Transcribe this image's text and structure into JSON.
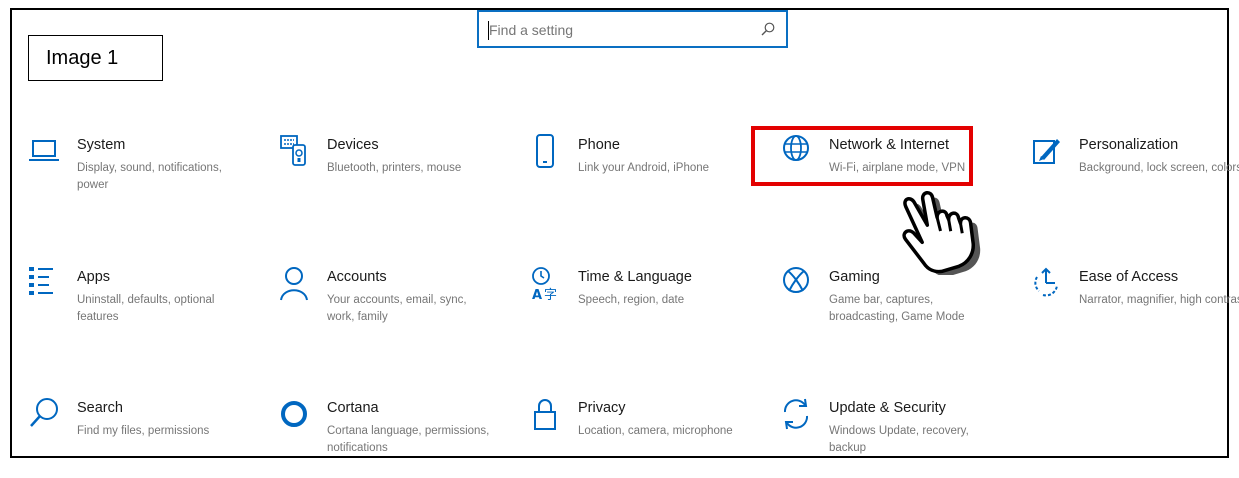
{
  "annotation": {
    "label": "Image 1"
  },
  "search": {
    "placeholder": "Find a setting",
    "icon": "search-icon"
  },
  "accent_color": "#0067c0",
  "highlight_color": "#e30000",
  "settings": [
    {
      "key": "system",
      "title": "System",
      "desc": "Display, sound, notifications, power",
      "icon": "laptop-icon"
    },
    {
      "key": "devices",
      "title": "Devices",
      "desc": "Bluetooth, printers, mouse",
      "icon": "devices-icon"
    },
    {
      "key": "phone",
      "title": "Phone",
      "desc": "Link your Android, iPhone",
      "icon": "phone-icon"
    },
    {
      "key": "network",
      "title": "Network & Internet",
      "desc": "Wi-Fi, airplane mode, VPN",
      "icon": "globe-icon",
      "highlighted": true
    },
    {
      "key": "personalization",
      "title": "Personalization",
      "desc": "Background, lock screen, colors",
      "icon": "paint-icon"
    },
    {
      "key": "apps",
      "title": "Apps",
      "desc": "Uninstall, defaults, optional features",
      "icon": "apps-list-icon"
    },
    {
      "key": "accounts",
      "title": "Accounts",
      "desc": "Your accounts, email, sync, work, family",
      "icon": "person-icon"
    },
    {
      "key": "time",
      "title": "Time & Language",
      "desc": "Speech, region, date",
      "icon": "time-language-icon"
    },
    {
      "key": "gaming",
      "title": "Gaming",
      "desc": "Game bar, captures, broadcasting, Game Mode",
      "icon": "xbox-icon"
    },
    {
      "key": "ease",
      "title": "Ease of Access",
      "desc": "Narrator, magnifier, high contrast",
      "icon": "ease-of-access-icon"
    },
    {
      "key": "search",
      "title": "Search",
      "desc": "Find my files, permissions",
      "icon": "magnifier-icon"
    },
    {
      "key": "cortana",
      "title": "Cortana",
      "desc": "Cortana language, permissions, notifications",
      "icon": "cortana-icon"
    },
    {
      "key": "privacy",
      "title": "Privacy",
      "desc": "Location, camera, microphone",
      "icon": "lock-icon"
    },
    {
      "key": "update",
      "title": "Update & Security",
      "desc": "Windows Update, recovery, backup",
      "icon": "update-icon"
    }
  ]
}
